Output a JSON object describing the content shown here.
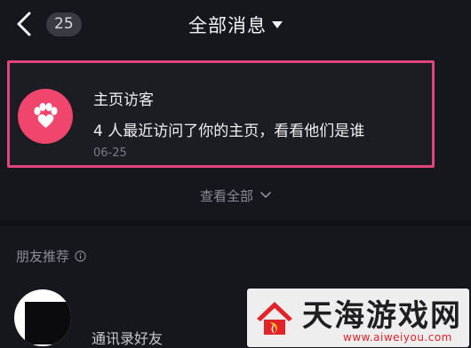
{
  "header": {
    "back_icon": "chevron-left-icon",
    "badge_count": "25",
    "title": "全部消息",
    "dropdown_icon": "caret-down-icon"
  },
  "notification": {
    "icon": "paw-heart-icon",
    "title": "主页访客",
    "description": "4 人最近访问了你的主页，看看他们是谁",
    "date": "06-25",
    "highlight_color": "#e0457c",
    "icon_bg_color": "#f0456d"
  },
  "view_all": {
    "label": "查看全部",
    "icon": "chevron-down-icon"
  },
  "friends": {
    "section_label": "朋友推荐",
    "info_icon": "info-icon",
    "items": [
      {
        "label": "通讯录好友"
      }
    ]
  },
  "watermark": {
    "text": "天海游戏网",
    "url": "www.aiweiyou.com"
  }
}
